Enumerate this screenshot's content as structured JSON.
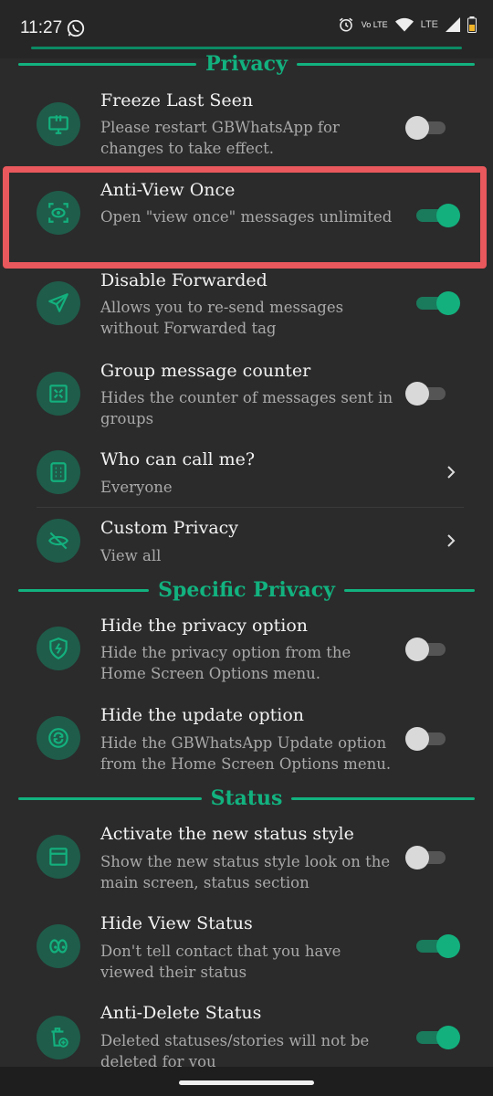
{
  "status_bar": {
    "time": "11:27",
    "network_label": "LTE",
    "volte_label": "Vo LTE",
    "icons": [
      "whatsapp-icon",
      "alarm-icon",
      "volte-icon",
      "wifi-icon",
      "signal-icon",
      "battery-icon"
    ]
  },
  "colors": {
    "background": "#2b2b2b",
    "accent": "#12b27f",
    "icon_bg": "#1f5c4a",
    "highlight_border": "#e8585c"
  },
  "sections": {
    "privacy": "Privacy",
    "specific_privacy": "Specific Privacy",
    "status": "Status"
  },
  "items": {
    "freeze_last_seen": {
      "title": "Freeze Last Seen",
      "subtitle": "Please restart GBWhatsApp for changes to take effect.",
      "enabled": false,
      "icon": "monitor-pin-icon"
    },
    "anti_view_once": {
      "title": "Anti-View Once",
      "subtitle": "Open \"view once\" messages unlimited",
      "enabled": true,
      "icon": "eye-scan-icon"
    },
    "disable_forwarded": {
      "title": "Disable Forwarded",
      "subtitle": "Allows you to re-send messages without Forwarded tag",
      "enabled": true,
      "icon": "send-icon"
    },
    "group_message_counter": {
      "title": "Group message counter",
      "subtitle": "Hides the counter of messages sent in groups",
      "enabled": false,
      "icon": "counter-box-icon"
    },
    "who_can_call": {
      "title": "Who can call me?",
      "subtitle": "Everyone",
      "icon": "phone-keypad-icon"
    },
    "custom_privacy": {
      "title": "Custom Privacy",
      "subtitle": "View all",
      "icon": "eye-off-icon"
    },
    "hide_privacy_option": {
      "title": "Hide the privacy option",
      "subtitle": "Hide the privacy option from the Home Screen Options menu.",
      "enabled": false,
      "icon": "shield-icon"
    },
    "hide_update_option": {
      "title": "Hide the update option",
      "subtitle": "Hide the GBWhatsApp Update option from the Home Screen Options menu.",
      "enabled": false,
      "icon": "refresh-icon"
    },
    "new_status_style": {
      "title": "Activate the new status style",
      "subtitle": "Show the new status style look on the main screen, status section",
      "enabled": false,
      "icon": "window-icon"
    },
    "hide_view_status": {
      "title": "Hide View Status",
      "subtitle": "Don't tell contact that you have viewed their status",
      "enabled": true,
      "icon": "eyes-icon"
    },
    "anti_delete_status": {
      "title": "Anti-Delete Status",
      "subtitle": "Deleted statuses/stories will not be deleted for you",
      "enabled": true,
      "icon": "trash-plus-icon"
    }
  }
}
